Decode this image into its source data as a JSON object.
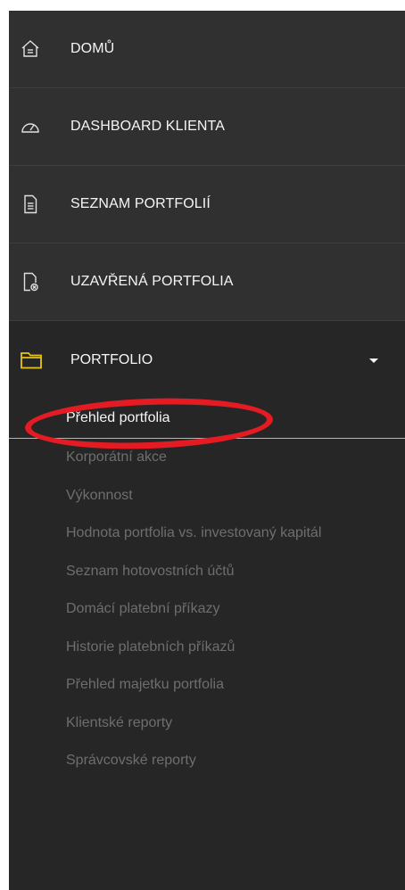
{
  "nav": {
    "items": [
      {
        "label": "DOMŮ",
        "icon": "home-icon"
      },
      {
        "label": "DASHBOARD KLIENTA",
        "icon": "gauge-icon"
      },
      {
        "label": "SEZNAM PORTFOLIÍ",
        "icon": "document-icon"
      },
      {
        "label": "UZAVŘENÁ PORTFOLIA",
        "icon": "closed-document-icon"
      }
    ],
    "portfolio": {
      "label": "PORTFOLIO",
      "icon": "folder-icon",
      "subitems": [
        {
          "label": "Přehled portfolia",
          "active": true
        },
        {
          "label": "Korporátní akce"
        },
        {
          "label": "Výkonnost"
        },
        {
          "label": "Hodnota portfolia vs. investovaný kapitál"
        },
        {
          "label": "Seznam hotovostních účtů"
        },
        {
          "label": "Domácí platební příkazy"
        },
        {
          "label": "Historie platebních příkazů"
        },
        {
          "label": "Přehled majetku portfolia"
        },
        {
          "label": "Klientské reporty"
        },
        {
          "label": "Správcovské reporty"
        }
      ]
    }
  },
  "colors": {
    "background": "#262626",
    "top_item_bg": "#303030",
    "text": "#f5f5f5",
    "muted_text": "#6e6e6e",
    "accent_yellow": "#d8c21a",
    "annotation_red": "#e51b24"
  }
}
